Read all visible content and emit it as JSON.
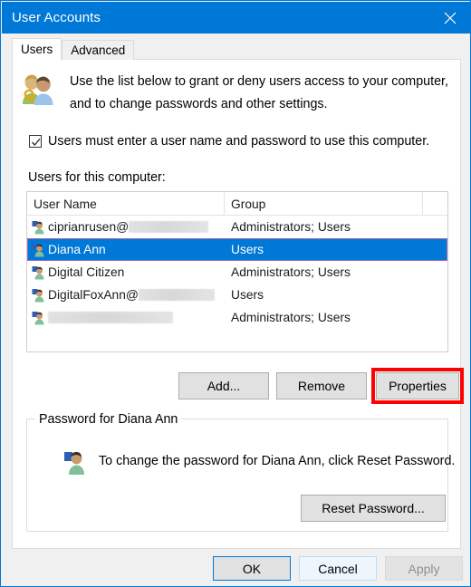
{
  "window": {
    "title": "User Accounts",
    "close_icon": "close-icon"
  },
  "tabs": [
    {
      "label": "Users",
      "active": true
    },
    {
      "label": "Advanced",
      "active": false
    }
  ],
  "intro": {
    "icon": "users-with-key-icon",
    "line1": "Use the list below to grant or deny users access to your computer,",
    "line2": "and to change passwords and other settings."
  },
  "require_login_checkbox": {
    "label": "Users must enter a user name and password to use this computer.",
    "checked": true
  },
  "list": {
    "label": "Users for this computer:",
    "columns": [
      "User Name",
      "Group",
      ""
    ],
    "rows": [
      {
        "user_name": "ciprianrusen@",
        "redacted_width": 88,
        "group": "Administrators; Users",
        "selected": false
      },
      {
        "user_name": "Diana Ann",
        "redacted_width": 0,
        "group": "Users",
        "selected": true
      },
      {
        "user_name": "Digital Citizen",
        "redacted_width": 0,
        "group": "Administrators; Users",
        "selected": false
      },
      {
        "user_name": "DigitalFoxAnn@",
        "redacted_width": 84,
        "group": "Users",
        "selected": false
      },
      {
        "user_name": "",
        "redacted_width": 138,
        "group": "Administrators; Users",
        "selected": false
      }
    ]
  },
  "list_buttons": {
    "add": "Add...",
    "remove": "Remove",
    "properties": "Properties",
    "highlight_color": "#fe0000"
  },
  "password_group": {
    "title": "Password for Diana Ann",
    "icon": "single-user-icon",
    "description": "To change the password for Diana Ann, click Reset Password.",
    "reset_button": "Reset Password..."
  },
  "footer": {
    "ok": "OK",
    "cancel": "Cancel",
    "apply": "Apply",
    "apply_enabled": false
  },
  "colors": {
    "titlebar": "#0078d7",
    "selection": "#0078d7",
    "dialog_background": "#f0f0f0",
    "page_background": "#ffffff"
  }
}
